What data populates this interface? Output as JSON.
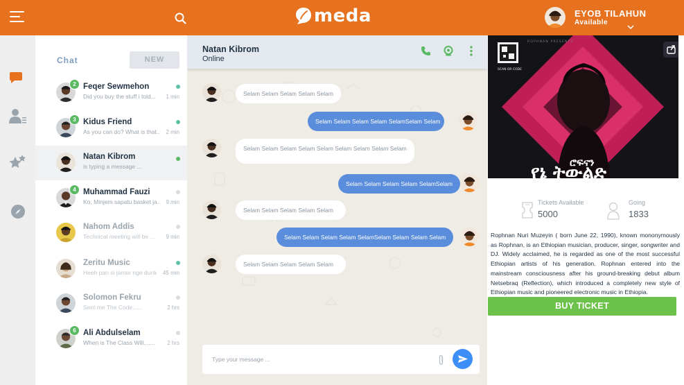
{
  "app": {
    "logo_text": "meda",
    "brand_color": "#e6711f"
  },
  "user": {
    "name": "EYOB TILAHUN",
    "status": "Available"
  },
  "nav_icons": [
    "chat-bubble-icon",
    "contacts-icon",
    "favorites-icon",
    "compass-icon"
  ],
  "chat_list": {
    "tab_label": "Chat",
    "new_label": "NEW",
    "items": [
      {
        "name": "Feqer Sewmehon",
        "preview": "Did you buy the stuff i told...",
        "time": "1 min",
        "badge": "2"
      },
      {
        "name": "Kidus  Friend",
        "preview": "As you can do? What is that...",
        "time": "2 min",
        "badge": "3"
      },
      {
        "name": "Natan  Kibrom",
        "preview": "is typing a message ...",
        "time": "",
        "badge": ""
      },
      {
        "name": "Muhammad Fauzi",
        "preview": "Ko, Minjem sapatu basket ja...",
        "time": "9 min",
        "badge": "4"
      },
      {
        "name": "Nahom Addis",
        "preview": "Technical meeting will be ...",
        "time": "9 min",
        "badge": ""
      },
      {
        "name": "Zeritu Music",
        "preview": "Heeh pan si jamar nge dunk",
        "time": "45 min",
        "badge": ""
      },
      {
        "name": "Solomon Fekru",
        "preview": "Sent me The Code......",
        "time": "2 hrs",
        "badge": ""
      },
      {
        "name": "Ali Abdulselam",
        "preview": "When is The Class Will.......",
        "time": "2 hrs",
        "badge": "6"
      }
    ]
  },
  "conversation": {
    "contact_name": "Natan Kibrom",
    "contact_status": "Online",
    "messages": [
      {
        "dir": "in",
        "text": "Selam Selam Selam Selam Selam"
      },
      {
        "dir": "out",
        "text": "Selam Selam Selam Selam SelamSelam Selam"
      },
      {
        "dir": "in",
        "text": "Selam Selam Selam Selam Selam Selam Selam Selam Selam"
      },
      {
        "dir": "out",
        "text": "Selam Selam Selam Selam SelamSelam"
      },
      {
        "dir": "in",
        "text": "Selam Selam Selam Selam Selam"
      },
      {
        "dir": "out",
        "text": "Selam Selam Selam Selam SelamSelam  Selam Selam Selam"
      },
      {
        "dir": "in",
        "text": "Selam Selam Selam Selam Selam"
      }
    ],
    "composer_placeholder": "Type your message ..."
  },
  "event": {
    "poster_presents": "ROPHNAN PRESENTS",
    "poster_scan": "SCAN OR CODE",
    "poster_title_amharic": "ሮፍናን",
    "poster_subtitle_amharic": "የኔ ትውልድ",
    "tickets_label": "Tickets Available",
    "tickets_value": "5000",
    "going_label": "Going",
    "going_value": "1833",
    "description": "Rophnan Nuri Muzeyin ( born June 22, 1990), known mononymously as Rophnan, is an Ethiopian musician, producer, singer, songwriter and DJ. Widely acclaimed, he is regarded as one of the most successful Ethiopian artists of his generation. Rophnan entered into the mainstream consciousness after his ground-breaking debut album Netsebraq (Reflection), which introduced a completely new style of Ethiopian music and pioneered electronic music in Ethiopia.",
    "buy_label": "BUY TICKET"
  }
}
